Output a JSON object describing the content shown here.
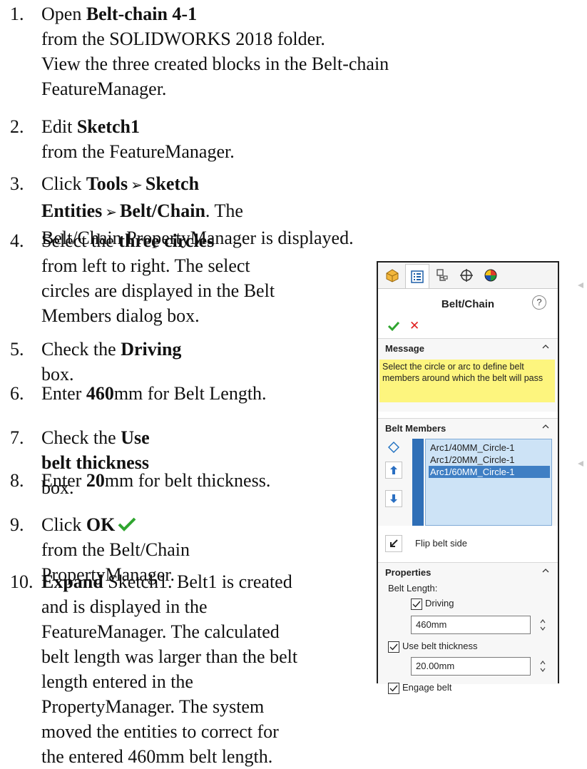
{
  "steps": [
    {
      "num": "1.",
      "lines": [
        [
          {
            "t": "Open "
          },
          {
            "t": "Belt-chain 4-1",
            "b": true
          },
          {
            "t": " from the SOLIDWORKS 2018 folder."
          }
        ],
        [
          {
            "t": "View the three created blocks in the Belt-chain"
          }
        ],
        [
          {
            "t": "FeatureManager."
          }
        ]
      ]
    },
    {
      "num": "2.",
      "lines": [
        [
          {
            "t": "Edit "
          },
          {
            "t": "Sketch1",
            "b": true
          },
          {
            "t": " from the FeatureManager."
          }
        ]
      ]
    },
    {
      "num": "3.",
      "lines": [
        [
          {
            "t": "Click "
          },
          {
            "t": "Tools",
            "b": true
          },
          {
            "t": "➢",
            "arrow": true
          },
          {
            "t": "Sketch Entities",
            "b": true
          },
          {
            "t": "➢",
            "arrow": true
          },
          {
            "t": "Belt/Chain",
            "b": true
          },
          {
            "t": ". The"
          }
        ],
        [
          {
            "t": "Belt/Chain PropertyManager is displayed."
          }
        ]
      ]
    },
    {
      "num": "4.",
      "lines": [
        [
          {
            "t": "Select the "
          },
          {
            "t": "three circles",
            "b": true
          },
          {
            "t": " from left to right. The select"
          }
        ],
        [
          {
            "t": "circles are displayed in the Belt"
          }
        ],
        [
          {
            "t": "Members dialog box."
          }
        ]
      ]
    },
    {
      "num": "5.",
      "lines": [
        [
          {
            "t": "Check the "
          },
          {
            "t": "Driving",
            "b": true
          },
          {
            "t": " box."
          }
        ]
      ]
    },
    {
      "num": "6.",
      "lines": [
        [
          {
            "t": "Enter "
          },
          {
            "t": "460",
            "b": true
          },
          {
            "t": "mm for Belt Length."
          }
        ]
      ]
    },
    {
      "num": "7.",
      "lines": [
        [
          {
            "t": "Check the "
          },
          {
            "t": "Use belt thickness",
            "b": true
          },
          {
            "t": " box."
          }
        ]
      ]
    },
    {
      "num": "8.",
      "lines": [
        [
          {
            "t": "Enter "
          },
          {
            "t": "20",
            "b": true
          },
          {
            "t": "mm for belt thickness."
          }
        ]
      ]
    },
    {
      "num": "9.",
      "lines": [
        [
          {
            "t": "Click "
          },
          {
            "t": "OK",
            "b": true
          },
          {
            "ok": true
          },
          {
            "t": " from the Belt/Chain"
          }
        ],
        [
          {
            "t": "PropertyManager."
          }
        ]
      ]
    },
    {
      "num": "10.",
      "lines": [
        [
          {
            "t": "Expand",
            "b": true
          },
          {
            "t": " Sketch1. Belt1 is created"
          }
        ],
        [
          {
            "t": "and is displayed in the"
          }
        ],
        [
          {
            "t": "FeatureManager. The calculated"
          }
        ],
        [
          {
            "t": "belt length was larger than the belt"
          }
        ],
        [
          {
            "t": "length entered in the"
          }
        ],
        [
          {
            "t": "PropertyManager. The system"
          }
        ],
        [
          {
            "t": "moved the entities to correct for"
          }
        ],
        [
          {
            "t": "the entered 460mm belt length."
          }
        ]
      ]
    }
  ],
  "panel": {
    "title": "Belt/Chain",
    "help": "?",
    "message_header": "Message",
    "message_text": "Select the circle or arc to define belt members around which the belt will pass",
    "members_header": "Belt Members",
    "members": [
      "Arc1/40MM_Circle-1",
      "Arc1/20MM_Circle-1",
      "Arc1/60MM_Circle-1"
    ],
    "selected_member_index": 2,
    "flip_label": "Flip belt side",
    "properties_header": "Properties",
    "belt_length_label": "Belt Length:",
    "driving_label": "Driving",
    "driving_checked": true,
    "belt_length_value": "460mm",
    "use_thickness_label": "Use belt thickness",
    "use_thickness_checked": true,
    "thickness_value": "20.00mm",
    "engage_label": "Engage belt",
    "engage_checked": true,
    "colors": {
      "ok": "#2fa52f",
      "cancel": "#e02020",
      "message_bg": "#fdf57e",
      "list_bg": "#cde3f6",
      "list_sel": "#3f7fc4"
    }
  }
}
